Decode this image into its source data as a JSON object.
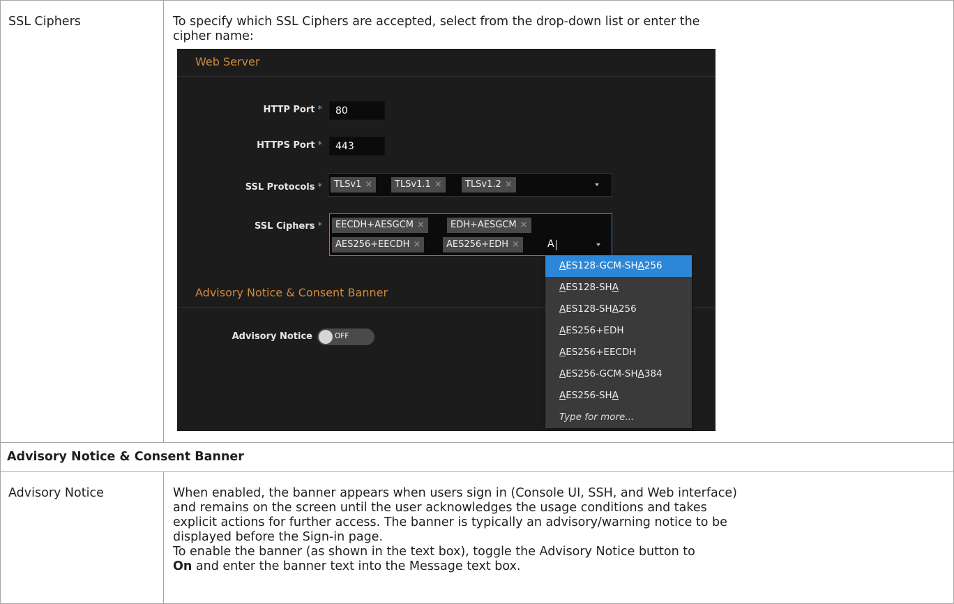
{
  "table": {
    "row1": {
      "label": "SSL Ciphers",
      "desc_line1": "To specify which SSL Ciphers are accepted, select from the drop-down list or enter the",
      "desc_line2": "cipher name:"
    },
    "section_header": "Advisory Notice & Consent Banner",
    "row2": {
      "label": "Advisory Notice",
      "lines": [
        "When enabled, the banner appears when users sign in (Console UI, SSH, and Web interface)",
        "and remains on the screen until the user acknowledges the usage conditions and takes",
        "explicit actions for further access. The banner is typically an advisory/warning notice to be",
        "displayed before the Sign-in page.",
        "To enable the banner (as shown in the text box), toggle the Advisory Notice button to"
      ],
      "last_line_bold": "On",
      "last_line_rest": " and enter the banner text into the Message text box."
    }
  },
  "screenshot": {
    "web_server_heading": "Web Server",
    "http_port": {
      "label": "HTTP Port",
      "required": "*",
      "value": "80"
    },
    "https_port": {
      "label": "HTTPS Port",
      "required": "*",
      "value": "443"
    },
    "ssl_protocols": {
      "label": "SSL Protocols",
      "required": "*",
      "tags": [
        "TLSv1",
        "TLSv1.1",
        "TLSv1.2"
      ]
    },
    "ssl_ciphers": {
      "label": "SSL Ciphers",
      "required": "*",
      "tags": [
        "EECDH+AESGCM",
        "EDH+AESGCM",
        "AES256+EECDH",
        "AES256+EDH"
      ],
      "typed": "A"
    },
    "remove_glyph": "×",
    "dropdown_options": [
      {
        "pre": "",
        "u1": "A",
        "mid": "ES128-GCM-SH",
        "u2": "A",
        "post": "256"
      },
      {
        "pre": "",
        "u1": "A",
        "mid": "ES128-SH",
        "u2": "A",
        "post": ""
      },
      {
        "pre": "",
        "u1": "A",
        "mid": "ES128-SH",
        "u2": "A",
        "post": "256"
      },
      {
        "pre": "",
        "u1": "A",
        "mid": "ES256+EDH",
        "u2": "",
        "post": ""
      },
      {
        "pre": "",
        "u1": "A",
        "mid": "ES256+EECDH",
        "u2": "",
        "post": ""
      },
      {
        "pre": "",
        "u1": "A",
        "mid": "ES256-GCM-SH",
        "u2": "A",
        "post": "384"
      },
      {
        "pre": "",
        "u1": "A",
        "mid": "ES256-SH",
        "u2": "A",
        "post": ""
      }
    ],
    "dropdown_more": "Type for more...",
    "advisory_heading": "Advisory Notice & Consent Banner",
    "advisory_notice": {
      "label": "Advisory Notice",
      "toggle_state": "OFF"
    },
    "colors": {
      "accent": "#2c87d8",
      "heading": "#d08a3c",
      "background": "#1c1c1c"
    }
  }
}
